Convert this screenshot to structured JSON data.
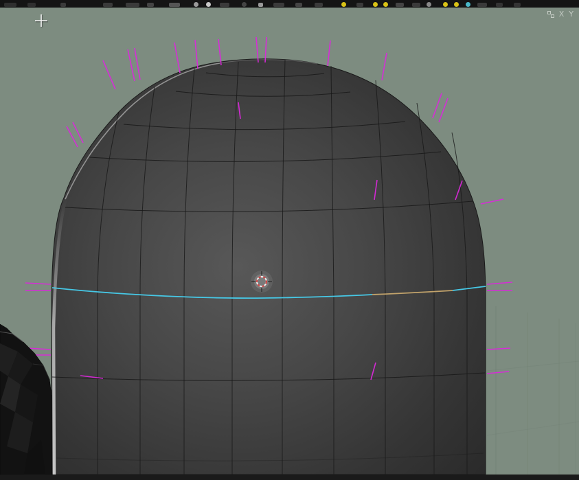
{
  "header": {
    "icons": [
      "menu-icon",
      "editor-type-icon",
      "mode-icon",
      "tool-icons",
      "snap-magnet-icon",
      "proportional-edit-icon",
      "pivot-icon",
      "shading-sphere-icon",
      "overlay-toggle-icon",
      "gizmo-toggle-icon",
      "xray-toggle-icon",
      "viewport-shading-icons"
    ]
  },
  "viewport": {
    "axis_labels": {
      "x": "X",
      "y": "Y"
    },
    "colors": {
      "background": "#7d8c80",
      "mesh_fill": "#3a3a3a",
      "wireframe": "#181818",
      "selected_edge_loop": "#46c8e6",
      "active_edge": "#c2a36b",
      "vertex_normals": "#dc29dc",
      "cursor": "#d04040",
      "silhouette_highlight": "#bdbdbd",
      "grid_line": "#6e7e72"
    },
    "overlays": [
      "3d-cursor",
      "vertex-normal-lines",
      "selected-edge-loop",
      "mouse-crosshair-cursor",
      "floor-grid"
    ]
  }
}
